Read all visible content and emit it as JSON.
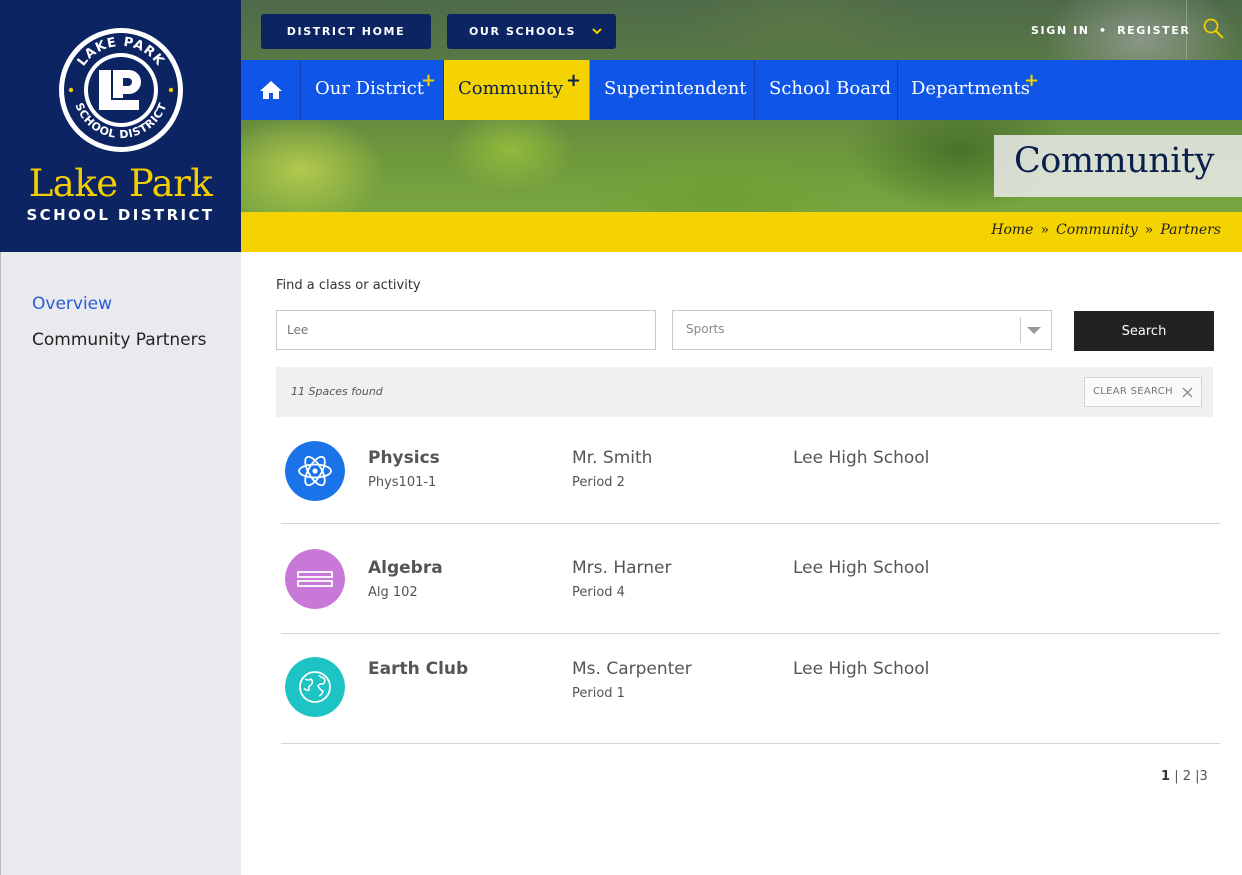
{
  "brand": {
    "seal_top_text": "LAKE PARK",
    "seal_bottom_text": "SCHOOL DISTRICT",
    "name": "Lake Park",
    "subtitle": "SCHOOL DISTRICT",
    "colors": {
      "navy": "#0c2461",
      "gold": "#f2cd00"
    }
  },
  "topbar": {
    "district_home": "DISTRICT HOME",
    "our_schools": "OUR SCHOOLS",
    "sign_in": "SIGN IN",
    "separator": "•",
    "register": "REGISTER"
  },
  "nav": {
    "home_icon": "home-icon",
    "items": [
      "Our District",
      "Community",
      "Superintendent",
      "School Board",
      "Departments"
    ],
    "plus": "+",
    "active": "Community",
    "colors": {
      "bar": "#0f56e8",
      "active": "#f5d300"
    }
  },
  "page": {
    "title": "Community",
    "breadcrumb": [
      "Home",
      "Community",
      "Partners"
    ],
    "breadcrumb_sep": "»"
  },
  "sidebar": {
    "items": [
      "Overview",
      "Community Partners"
    ]
  },
  "search": {
    "label": "Find a class or activity",
    "query": "Lee",
    "category": "Sports",
    "button": "Search",
    "results_count": "11 Spaces found",
    "clear": "CLEAR SEARCH"
  },
  "results": [
    {
      "name": "Physics",
      "code": "Phys101-1",
      "teacher": "Mr. Smith",
      "period": "Period 2",
      "school": "Lee High School",
      "icon": "atom-icon",
      "color": "#1a73e8"
    },
    {
      "name": "Algebra",
      "code": "Alg 102",
      "teacher": "Mrs. Harner",
      "period": "Period 4",
      "school": "Lee High School",
      "icon": "equals-bars-icon",
      "color": "#c879d8"
    },
    {
      "name": "Earth Club",
      "code": "",
      "teacher": "Ms. Carpenter",
      "period": "Period 1",
      "school": "Lee High School",
      "icon": "globe-icon",
      "color": "#1ec4c4"
    }
  ],
  "pagination": {
    "current": "1",
    "pages": [
      "2",
      "3"
    ],
    "sep": "|"
  }
}
